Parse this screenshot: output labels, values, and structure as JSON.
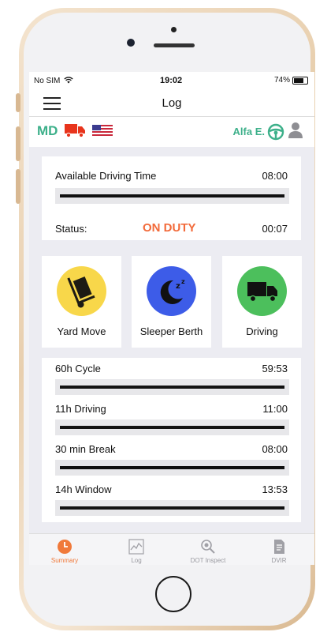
{
  "statusbar": {
    "carrier": "No SIM",
    "time": "19:02",
    "battery": "74%",
    "battery_level": 0.74
  },
  "navbar": {
    "title": "Log"
  },
  "infobar": {
    "state": "MD",
    "driver": "Alfa E."
  },
  "available": {
    "label": "Available Driving Time",
    "value": "08:00",
    "progress": 1.0
  },
  "status": {
    "label": "Status:",
    "value": "ON DUTY",
    "time": "00:07"
  },
  "modes": [
    {
      "label": "Yard Move",
      "icon": "hand-truck-icon",
      "color": "#f8d74a"
    },
    {
      "label": "Sleeper Berth",
      "icon": "sleep-moon-icon",
      "color": "#3d5ce8"
    },
    {
      "label": "Driving",
      "icon": "truck-icon",
      "color": "#4cbf5c"
    }
  ],
  "timers": [
    {
      "label": "60h Cycle",
      "value": "59:53",
      "progress": 1.0
    },
    {
      "label": "11h Driving",
      "value": "11:00",
      "progress": 1.0
    },
    {
      "label": "30 min Break",
      "value": "08:00",
      "progress": 1.0
    },
    {
      "label": "14h Window",
      "value": "13:53",
      "progress": 1.0
    }
  ],
  "tabs": [
    {
      "label": "Summary",
      "icon": "clock-icon",
      "active": true
    },
    {
      "label": "Log",
      "icon": "chart-icon",
      "active": false
    },
    {
      "label": "DOT Inspect",
      "icon": "magnifier-icon",
      "active": false
    },
    {
      "label": "DVIR",
      "icon": "document-icon",
      "active": false
    }
  ],
  "colors": {
    "accent_green": "#3db08a",
    "status_orange": "#f26a3a",
    "tab_active": "#f0793a"
  }
}
